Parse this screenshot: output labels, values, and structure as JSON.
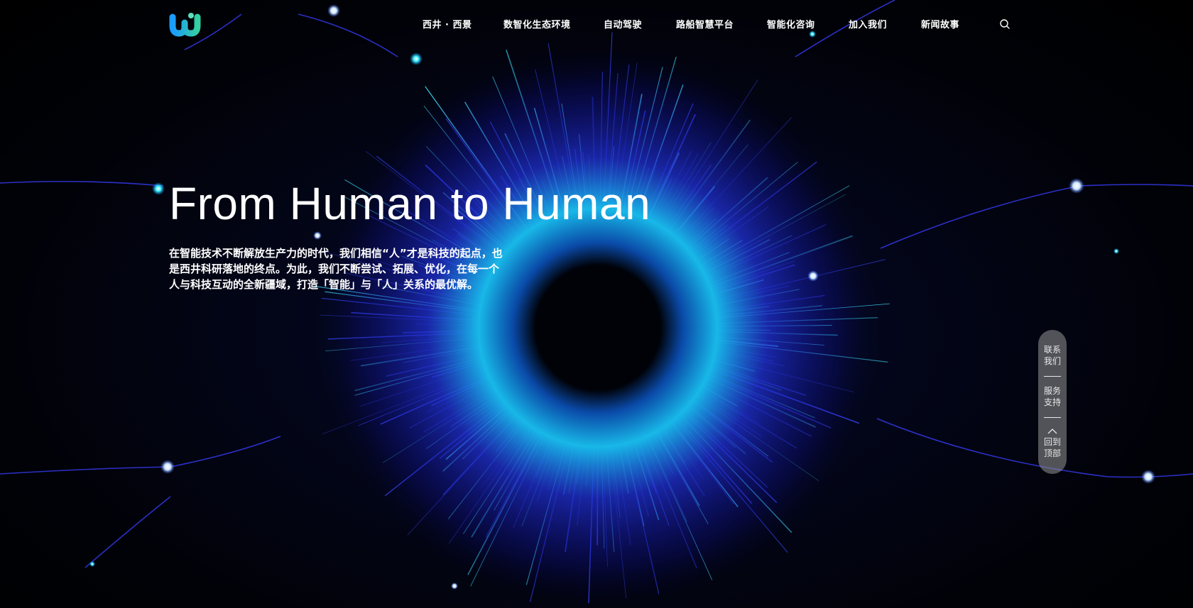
{
  "header": {
    "nav": [
      {
        "label": "西井 · 西景"
      },
      {
        "label": "数智化生态环境"
      },
      {
        "label": "自动驾驶"
      },
      {
        "label": "路船智慧平台"
      },
      {
        "label": "智能化咨询"
      },
      {
        "label": "加入我们"
      },
      {
        "label": "新闻故事"
      }
    ],
    "search_icon": "search-icon"
  },
  "hero": {
    "title": "From Human to Human",
    "description_lines": [
      "在智能技术不断解放生产力的时代，我们相信“人”才是科技的起点，也",
      "是西井科研落地的终点。为此，我们不断尝试、拓展、优化，在每一个",
      "人与科技互动的全新疆域，打造「智能」与「人」关系的最优解。"
    ]
  },
  "side_widget": {
    "contact": [
      "联系",
      "我们"
    ],
    "support": [
      "服务",
      "支持"
    ],
    "top": [
      "回到",
      "顶部"
    ],
    "top_icon": "chevron-up-icon"
  },
  "colors": {
    "background": "#020309",
    "glow_cyan": "#36e6ff",
    "glow_blue": "#2a3cff",
    "logo_blue": "#1a9cff",
    "logo_green": "#33d0a0"
  }
}
